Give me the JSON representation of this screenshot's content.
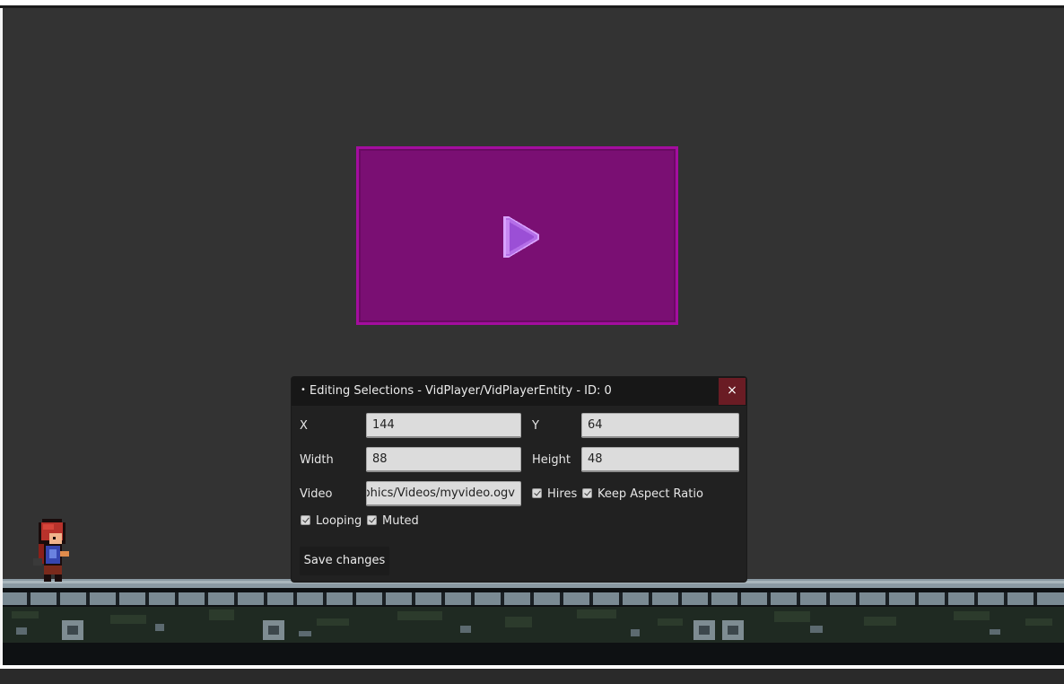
{
  "dialog": {
    "title": "Editing Selections - VidPlayer/VidPlayerEntity - ID: 0",
    "close_label": "×",
    "fields": {
      "x": {
        "label": "X",
        "value": "144"
      },
      "y": {
        "label": "Y",
        "value": "64"
      },
      "width": {
        "label": "Width",
        "value": "88"
      },
      "height": {
        "label": "Height",
        "value": "48"
      },
      "video": {
        "label": "Video",
        "value": "Graphics/Videos/myvideo.ogv"
      }
    },
    "checkboxes": {
      "hires": {
        "label": "Hires",
        "checked": true
      },
      "keep_aspect": {
        "label": "Keep Aspect Ratio",
        "checked": true
      },
      "looping": {
        "label": "Looping",
        "checked": true
      },
      "muted": {
        "label": "Muted",
        "checked": true
      }
    },
    "save_label": "Save changes"
  },
  "icons": {
    "play": "play-icon",
    "close": "close-icon",
    "checkbox": "checkmark-icon"
  },
  "colors": {
    "background": "#333333",
    "vid_fill": "#7a0f73",
    "vid_border": "#a40d9f",
    "play": "#b46ee8",
    "close_button": "#6a1c24",
    "dialog_bg": "#212121"
  }
}
